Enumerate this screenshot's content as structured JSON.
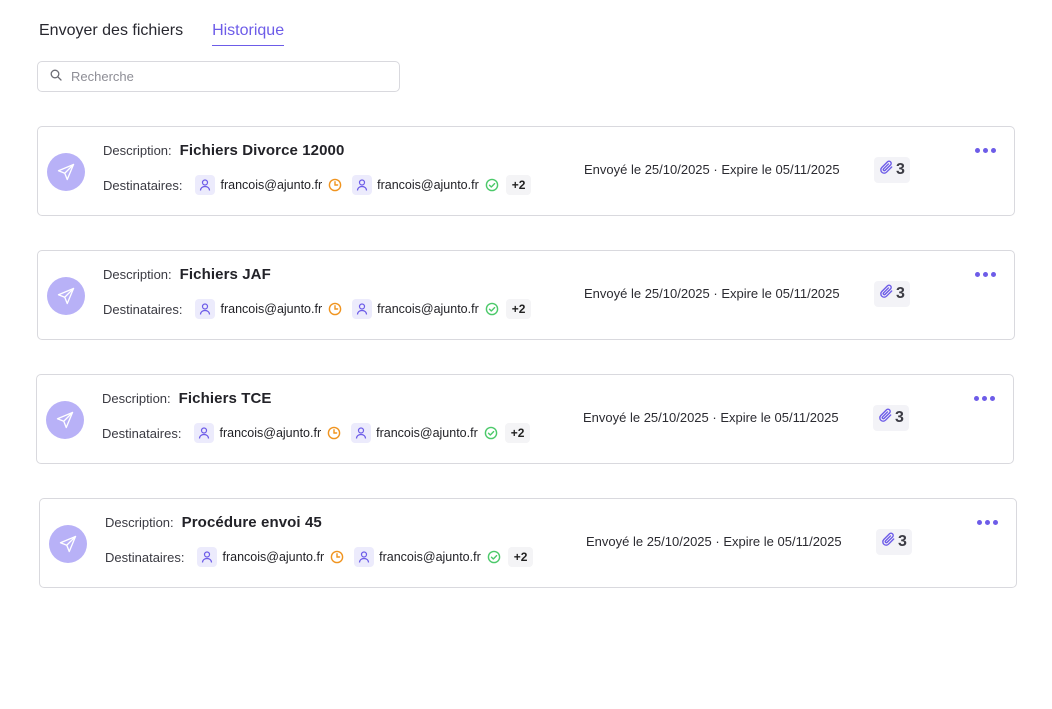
{
  "tabs": [
    {
      "label": "Envoyer des fichiers",
      "active": false
    },
    {
      "label": "Historique",
      "active": true
    }
  ],
  "search": {
    "placeholder": "Recherche",
    "value": ""
  },
  "labels": {
    "description": "Description:",
    "recipients": "Destinataires:"
  },
  "colors": {
    "accent": "#6d5ce8",
    "send_circle": "#b8b1f7",
    "pending": "#f0941f",
    "delivered": "#4cc96a"
  },
  "transfers": [
    {
      "description": "Fichiers Divorce 12000",
      "recipients": [
        {
          "email": "francois@ajunto.fr",
          "status": "pending-clock-icon"
        },
        {
          "email": "francois@ajunto.fr",
          "status": "check-circle-icon"
        }
      ],
      "more_recipients": "+2",
      "dates": "Envoyé le 25/10/2025 · Expire le 05/11/2025",
      "attachments": "3"
    },
    {
      "description": "Fichiers JAF",
      "recipients": [
        {
          "email": "francois@ajunto.fr",
          "status": "pending-clock-icon"
        },
        {
          "email": "francois@ajunto.fr",
          "status": "check-circle-icon"
        }
      ],
      "more_recipients": "+2",
      "dates": "Envoyé le 25/10/2025 · Expire le 05/11/2025",
      "attachments": "3"
    },
    {
      "description": "Fichiers TCE",
      "recipients": [
        {
          "email": "francois@ajunto.fr",
          "status": "pending-clock-icon"
        },
        {
          "email": "francois@ajunto.fr",
          "status": "check-circle-icon"
        }
      ],
      "more_recipients": "+2",
      "dates": "Envoyé le 25/10/2025 · Expire le 05/11/2025",
      "attachments": "3"
    },
    {
      "description": "Procédure envoi 45",
      "recipients": [
        {
          "email": "francois@ajunto.fr",
          "status": "pending-clock-icon"
        },
        {
          "email": "francois@ajunto.fr",
          "status": "check-circle-icon"
        }
      ],
      "more_recipients": "+2",
      "dates": "Envoyé le 25/10/2025 · Expire le 05/11/2025",
      "attachments": "3"
    }
  ]
}
